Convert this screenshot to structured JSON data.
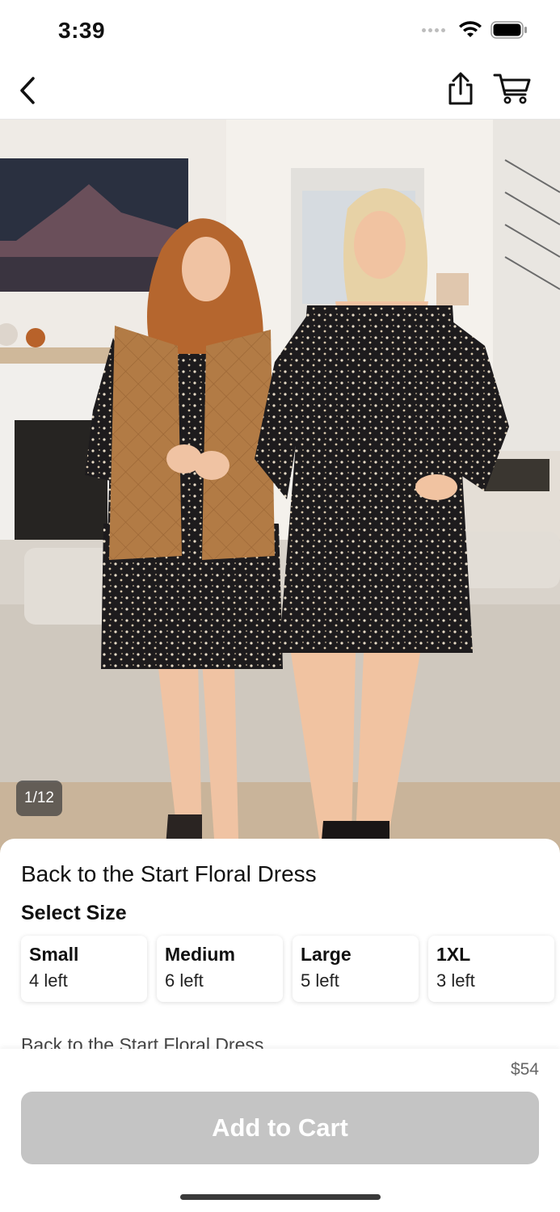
{
  "status_bar": {
    "time": "3:39",
    "icons": [
      "signal-dots-icon",
      "wifi-icon",
      "battery-icon"
    ]
  },
  "nav": {
    "back_icon": "chevron-left-icon",
    "share_icon": "share-icon",
    "cart_icon": "cart-icon"
  },
  "gallery": {
    "counter": "1/12"
  },
  "product": {
    "title": "Back to the Start Floral Dress",
    "select_size_label": "Select Size",
    "sizes": [
      {
        "name": "Small",
        "stock": "4 left"
      },
      {
        "name": "Medium",
        "stock": "6 left"
      },
      {
        "name": "Large",
        "stock": "5 left"
      },
      {
        "name": "1XL",
        "stock": "3 left"
      }
    ],
    "description_peek": "Back to the Start Floral Dress"
  },
  "footer": {
    "price": "$54",
    "add_to_cart_label": "Add to Cart"
  },
  "colors": {
    "button_disabled": "#c4c4c4",
    "accent_text": "#111111"
  }
}
